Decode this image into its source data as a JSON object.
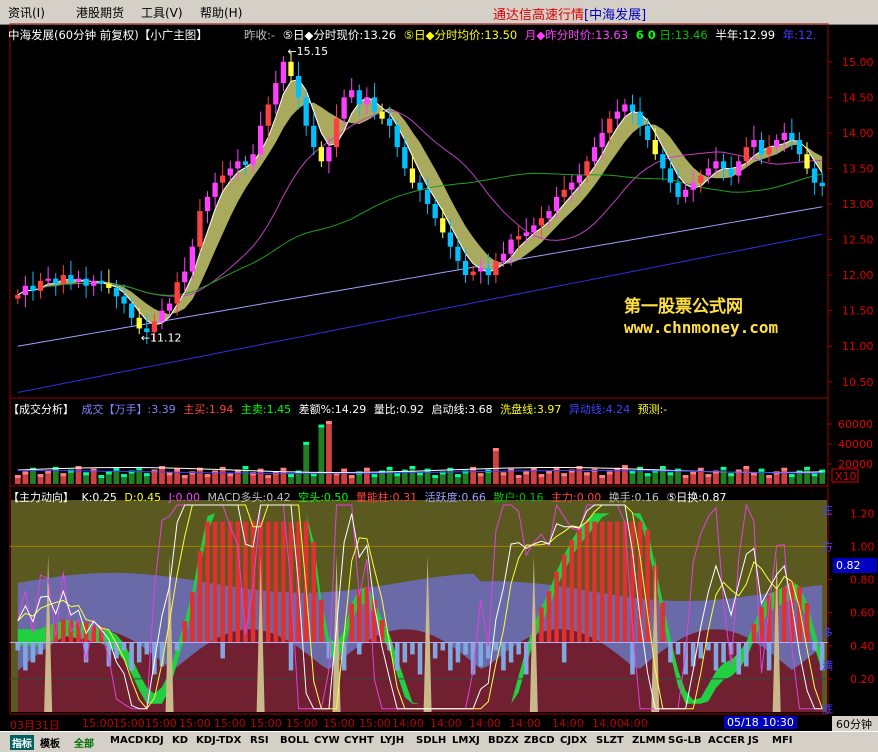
{
  "menu": [
    "资讯(I)",
    "港股期货",
    "工具(V)",
    "帮助(H)"
  ],
  "app_title": {
    "main": "通达信高速行情",
    "sub": "[中海发展]"
  },
  "header": {
    "stock": "中海发展(60分钟 前复权)【小广主图】",
    "items": [
      {
        "text": "昨收:-",
        "color": "#c0c0c0"
      },
      {
        "text": "⑤日◆分时现价:13.26",
        "color": "#ffffff"
      },
      {
        "text": "⑤日◆分时均价:13.50",
        "color": "#ffff00"
      },
      {
        "text": "月◆昨分时价:13.63",
        "color": "#ff40ff"
      },
      {
        "text": "6 0",
        "color": "#00ff00"
      },
      {
        "text": "日:13.46",
        "color": "#00c000"
      },
      {
        "text": "半年:12.99",
        "color": "#ffffff"
      },
      {
        "text": "年:12.",
        "color": "#4040ff"
      }
    ]
  },
  "price_axis": [
    "15.00",
    "14.50",
    "14.00",
    "13.50",
    "13.00",
    "12.50",
    "12.00",
    "11.50",
    "11.00",
    "10.50"
  ],
  "annotations": {
    "high": "15.15",
    "low": "11.12"
  },
  "watermark": {
    "line1": "第一股票公式网",
    "line2": "www.chnmoney.com"
  },
  "volume_header": {
    "items": [
      {
        "text": "【成交分析】",
        "color": "#ffffff"
      },
      {
        "text": "成交【万手】:3.39",
        "color": "#8080ff"
      },
      {
        "text": "主买:1.94",
        "color": "#ff4040"
      },
      {
        "text": "主卖:1.45",
        "color": "#00ff00"
      },
      {
        "text": "差额%:14.29",
        "color": "#ffffff"
      },
      {
        "text": "量比:0.92",
        "color": "#ffffff"
      },
      {
        "text": "启动线:3.68",
        "color": "#ffffff"
      },
      {
        "text": "洗盘线:3.97",
        "color": "#ffff00"
      },
      {
        "text": "异动线:4.24",
        "color": "#4040ff"
      },
      {
        "text": "预测:-",
        "color": "#ffff00"
      }
    ]
  },
  "volume_axis": [
    "60000",
    "40000",
    "20000"
  ],
  "volume_unit": "X10",
  "indicator_header": {
    "items": [
      {
        "text": "【主力动向】",
        "color": "#ffffff"
      },
      {
        "text": "K:0.25",
        "color": "#ffffff"
      },
      {
        "text": "D:0.45",
        "color": "#ffff00"
      },
      {
        "text": "J:0.00",
        "color": "#ff40ff"
      },
      {
        "text": "MACD多头:0.42",
        "color": "#c0c0c0"
      },
      {
        "text": "空头:0.50",
        "color": "#00ff00"
      },
      {
        "text": "量能柱:0.31",
        "color": "#ff4040"
      },
      {
        "text": "活跃度:0.66",
        "color": "#a0a0ff"
      },
      {
        "text": "散户:0.16",
        "color": "#00c000"
      },
      {
        "text": "主力:0.00",
        "color": "#ff4040"
      },
      {
        "text": "换手:0.16",
        "color": "#c0c0c0"
      },
      {
        "text": "⑤日换:0.87",
        "color": "#ffffff"
      }
    ]
  },
  "indicator_axis": [
    "1.20",
    "1.00",
    "0.80",
    "0.60",
    "0.40",
    "0.20"
  ],
  "indicator_current": "0.82",
  "side_labels": [
    "庄",
    "方",
    "多",
    "满",
    "底"
  ],
  "time_labels": [
    "03月31日",
    "15:00",
    "15:00",
    "15:00",
    "15:00",
    "15:00",
    "15:00",
    "15:00",
    "15:00",
    "15:00",
    "14:00",
    "14:00",
    "14:00",
    "14:00",
    "14:00",
    "14:00",
    "4:00"
  ],
  "time_readout": "05/18 10:30",
  "period": "60分钟",
  "tabs": [
    "指标",
    "模板",
    "全部",
    "MACD",
    "KDJ",
    "KD",
    "KDJ-TDX",
    "RSI",
    "BOLL",
    "CYW",
    "CYHT",
    "LYJH",
    "SDLH",
    "LMXJ",
    "BDZX",
    "ZBCD",
    "CJDX",
    "SLZT",
    "ZLMM",
    "SG-LB",
    "ACCER",
    "JS",
    "MFI"
  ],
  "chart_data": {
    "type": "candlestick",
    "ylim": [
      10.3,
      15.25
    ],
    "closes": [
      11.72,
      11.85,
      11.78,
      11.92,
      11.95,
      11.88,
      12.0,
      11.9,
      11.95,
      11.85,
      11.92,
      11.88,
      11.82,
      11.7,
      11.6,
      11.4,
      11.25,
      11.2,
      11.35,
      11.5,
      11.6,
      11.9,
      12.05,
      12.4,
      12.9,
      13.1,
      13.3,
      13.4,
      13.5,
      13.6,
      13.55,
      13.7,
      14.1,
      14.4,
      14.7,
      15.0,
      14.8,
      14.5,
      14.1,
      13.8,
      13.6,
      13.8,
      14.2,
      14.5,
      14.6,
      14.4,
      14.5,
      14.3,
      14.2,
      14.1,
      13.8,
      13.5,
      13.3,
      13.2,
      13.0,
      12.8,
      12.6,
      12.4,
      12.2,
      12.0,
      12.05,
      12.1,
      12.0,
      12.2,
      12.3,
      12.5,
      12.55,
      12.6,
      12.7,
      12.8,
      12.9,
      13.1,
      13.2,
      13.3,
      13.4,
      13.6,
      13.8,
      14.0,
      14.2,
      14.3,
      14.4,
      14.3,
      14.1,
      13.9,
      13.7,
      13.5,
      13.3,
      13.1,
      13.2,
      13.3,
      13.4,
      13.5,
      13.6,
      13.5,
      13.4,
      13.6,
      13.8,
      13.9,
      13.7,
      13.8,
      13.9,
      14.0,
      13.9,
      13.7,
      13.5,
      13.3,
      13.25
    ]
  }
}
